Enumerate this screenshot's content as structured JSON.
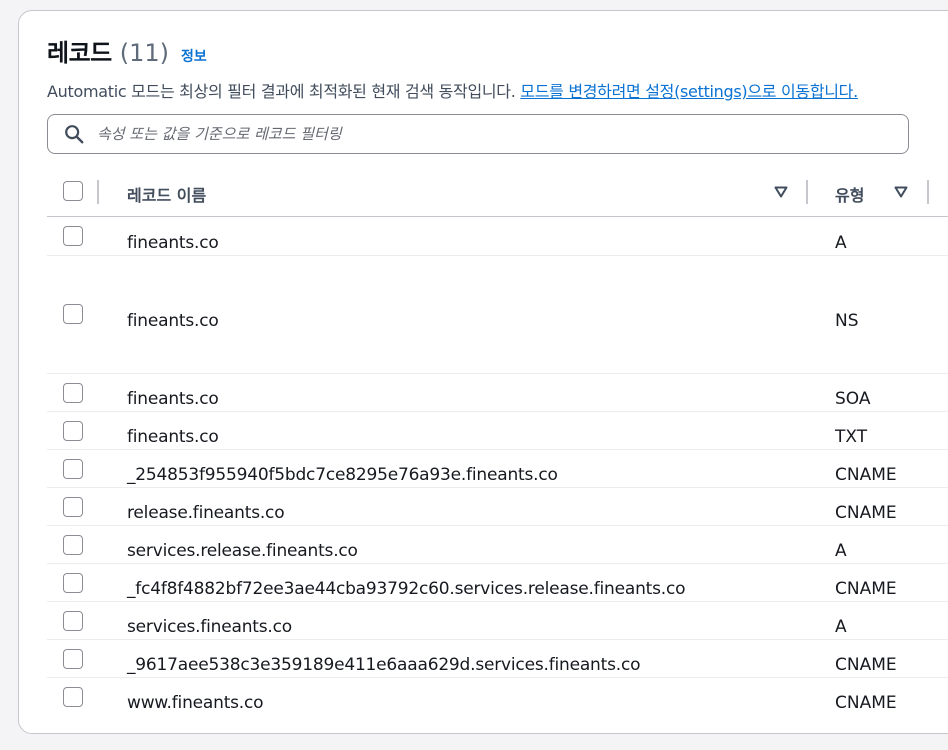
{
  "header": {
    "title": "레코드",
    "count": "(11)",
    "info_link": "정보"
  },
  "description": {
    "text": "Automatic 모드는 최상의 필터 결과에 최적화된 현재 검색 동작입니다. ",
    "link": "모드를 변경하려면 설정(settings)으로 이동합니다."
  },
  "search": {
    "placeholder": "속성 또는 값을 기준으로 레코드 필터링",
    "value": ""
  },
  "table": {
    "columns": [
      "레코드 이름",
      "유형"
    ],
    "rows": [
      {
        "name": "fineants.co",
        "type": "A"
      },
      {
        "name": "fineants.co",
        "type": "NS"
      },
      {
        "name": "fineants.co",
        "type": "SOA"
      },
      {
        "name": "fineants.co",
        "type": "TXT"
      },
      {
        "name": "_254853f955940f5bdc7ce8295e76a93e.fineants.co",
        "type": "CNAME"
      },
      {
        "name": "release.fineants.co",
        "type": "CNAME"
      },
      {
        "name": "services.release.fineants.co",
        "type": "A"
      },
      {
        "name": "_fc4f8f4882bf72ee3ae44cba93792c60.services.release.fineants.co",
        "type": "CNAME"
      },
      {
        "name": "services.fineants.co",
        "type": "A"
      },
      {
        "name": "_9617aee538c3e359189e411e6aaa629d.services.fineants.co",
        "type": "CNAME"
      },
      {
        "name": "www.fineants.co",
        "type": "CNAME"
      }
    ]
  },
  "icons": {
    "search": "search-icon",
    "sort": "caret-down-icon"
  },
  "colors": {
    "link": "#0972d3",
    "border": "#c6c6cd",
    "text": "#16191f"
  }
}
